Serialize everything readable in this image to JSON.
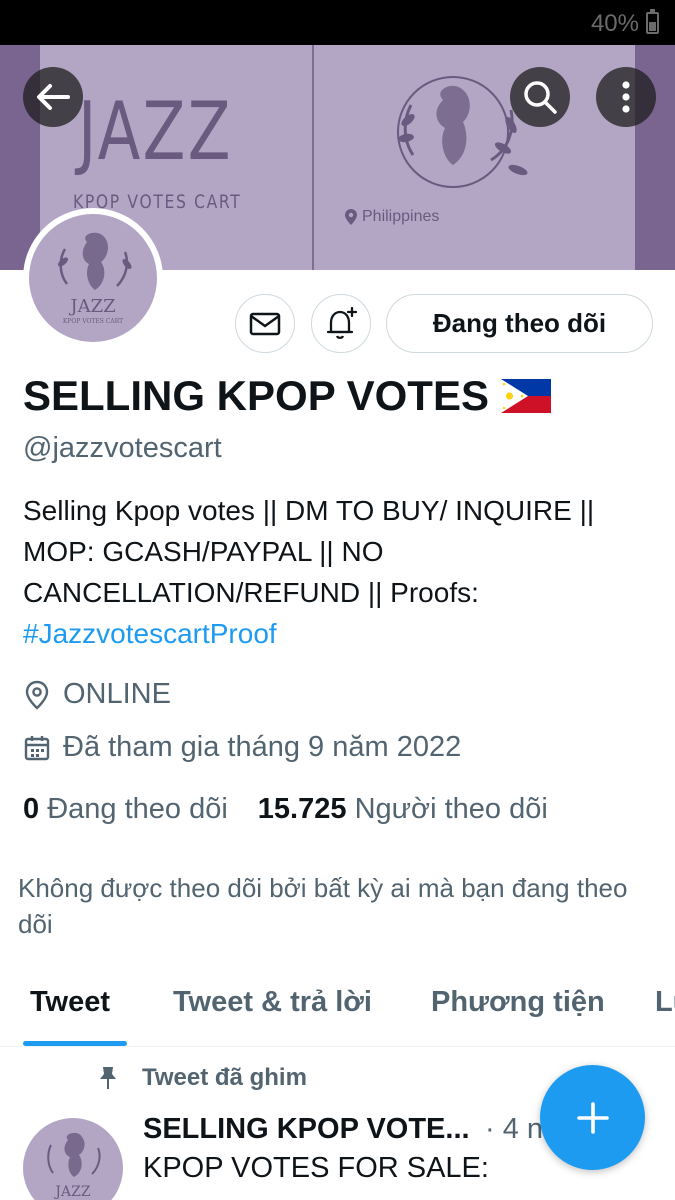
{
  "status_bar": {
    "battery": "40%"
  },
  "banner": {
    "title": "JAZZ",
    "subtitle": "KPOP VOTES CART",
    "location": "Philippines",
    "colors": {
      "outer": "#7a6590",
      "inner": "#b3a6c4",
      "ink": "#6a5a80"
    }
  },
  "avatar": {
    "title": "JAZZ",
    "subtitle": "KPOP VOTES CART"
  },
  "header_buttons": {
    "back": "back-arrow-icon",
    "search": "search-icon",
    "more": "more-vertical-icon"
  },
  "actions": {
    "follow_label": "Đang theo dõi",
    "dm_icon": "mail-icon",
    "notify_icon": "bell-plus-icon"
  },
  "profile": {
    "display_name": "SELLING KPOP VOTES",
    "flag": "philippines-flag",
    "handle": "@jazzvotescart",
    "bio_text": "Selling Kpop votes || DM TO BUY/ INQUIRE || MOP: GCASH/PAYPAL || NO CANCELLATION/REFUND || Proofs: ",
    "bio_hashtag": "#JazzvotescartProof",
    "location": "ONLINE",
    "joined": "Đã tham gia tháng 9 năm 2022",
    "following_count": "0",
    "following_label": "Đang theo dõi",
    "followers_count": "15.725",
    "followers_label": "Người theo dõi",
    "followers_note": "Không được theo dõi bởi bất kỳ ai mà bạn đang theo dõi"
  },
  "tabs": [
    {
      "label": "Tweet",
      "active": true
    },
    {
      "label": "Tweet & trả lời",
      "active": false
    },
    {
      "label": "Phương tiện",
      "active": false
    },
    {
      "label": "Lư",
      "active": false
    }
  ],
  "pinned_tweet": {
    "pinned_label": "Tweet đã ghim",
    "author": "SELLING KPOP VOTE...",
    "time": "· 4 n",
    "text": "KPOP VOTES FOR SALE:"
  },
  "fab": {
    "icon": "plus-icon"
  },
  "colors": {
    "accent": "#1d9bf0",
    "text": "#0f1419",
    "secondary": "#536471"
  }
}
